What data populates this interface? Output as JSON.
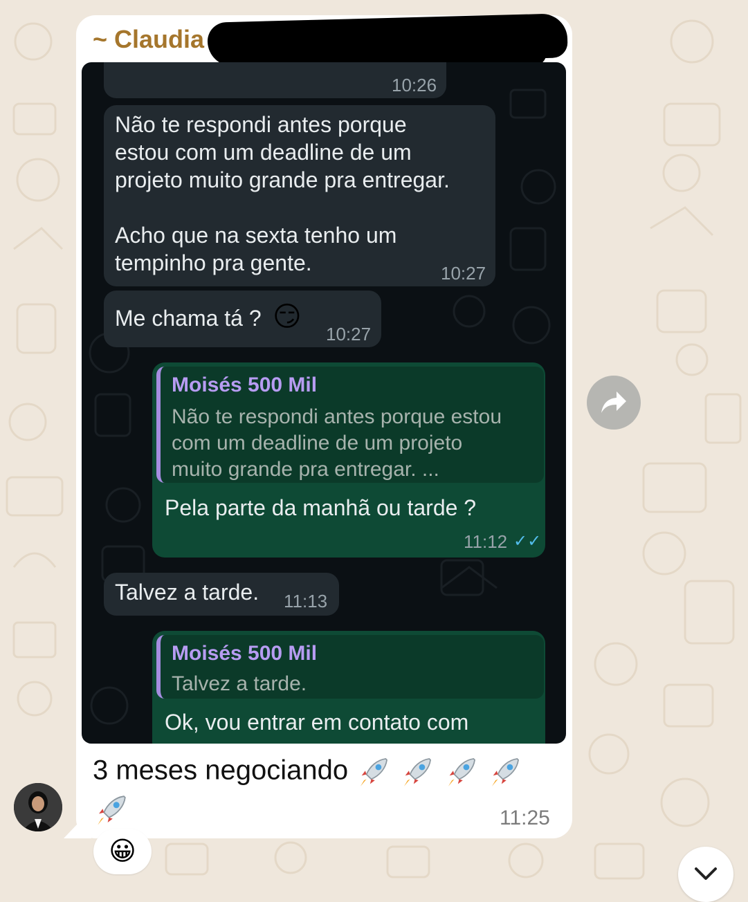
{
  "sender": {
    "name": "~ Claudia C"
  },
  "screenshot": {
    "messages": [
      {
        "time": "10:26"
      },
      {
        "text": "Não te respondi antes porque\nestou com um deadline de um\nprojeto muito grande pra entregar.\n\nAcho que na sexta tenho um\ntempinho pra gente.",
        "time": "10:27"
      },
      {
        "text": "Me chama tá ?",
        "emoji": "😏",
        "time": "10:27"
      },
      {
        "quote_name": "Moisés 500 Mil",
        "quote_text": "Não te respondi antes porque estou\ncom um deadline de um projeto\nmuito grande pra entregar. ...",
        "text": "Pela parte da manhã ou tarde ?",
        "time": "11:12",
        "status": "✓✓"
      },
      {
        "text": "Talvez a tarde.",
        "time": "11:13"
      },
      {
        "quote_name": "Moisés 500 Mil",
        "quote_text": "Talvez a tarde.",
        "text": "Ok, vou entrar em contato com"
      }
    ]
  },
  "caption": {
    "text": "3 meses negociando",
    "time": "11:25"
  },
  "reaction": {
    "emoji": "😀"
  },
  "icons": {
    "forward": "forward-arrow-icon",
    "scroll": "chevron-down-icon",
    "rocket": "rocket-emoji"
  },
  "colors": {
    "sender": "#a5762c",
    "outgoing_bubble": "#0e4a35",
    "incoming_bubble": "#222a30",
    "quote_bar": "#a58de0",
    "read_ticks": "#53bdeb"
  }
}
